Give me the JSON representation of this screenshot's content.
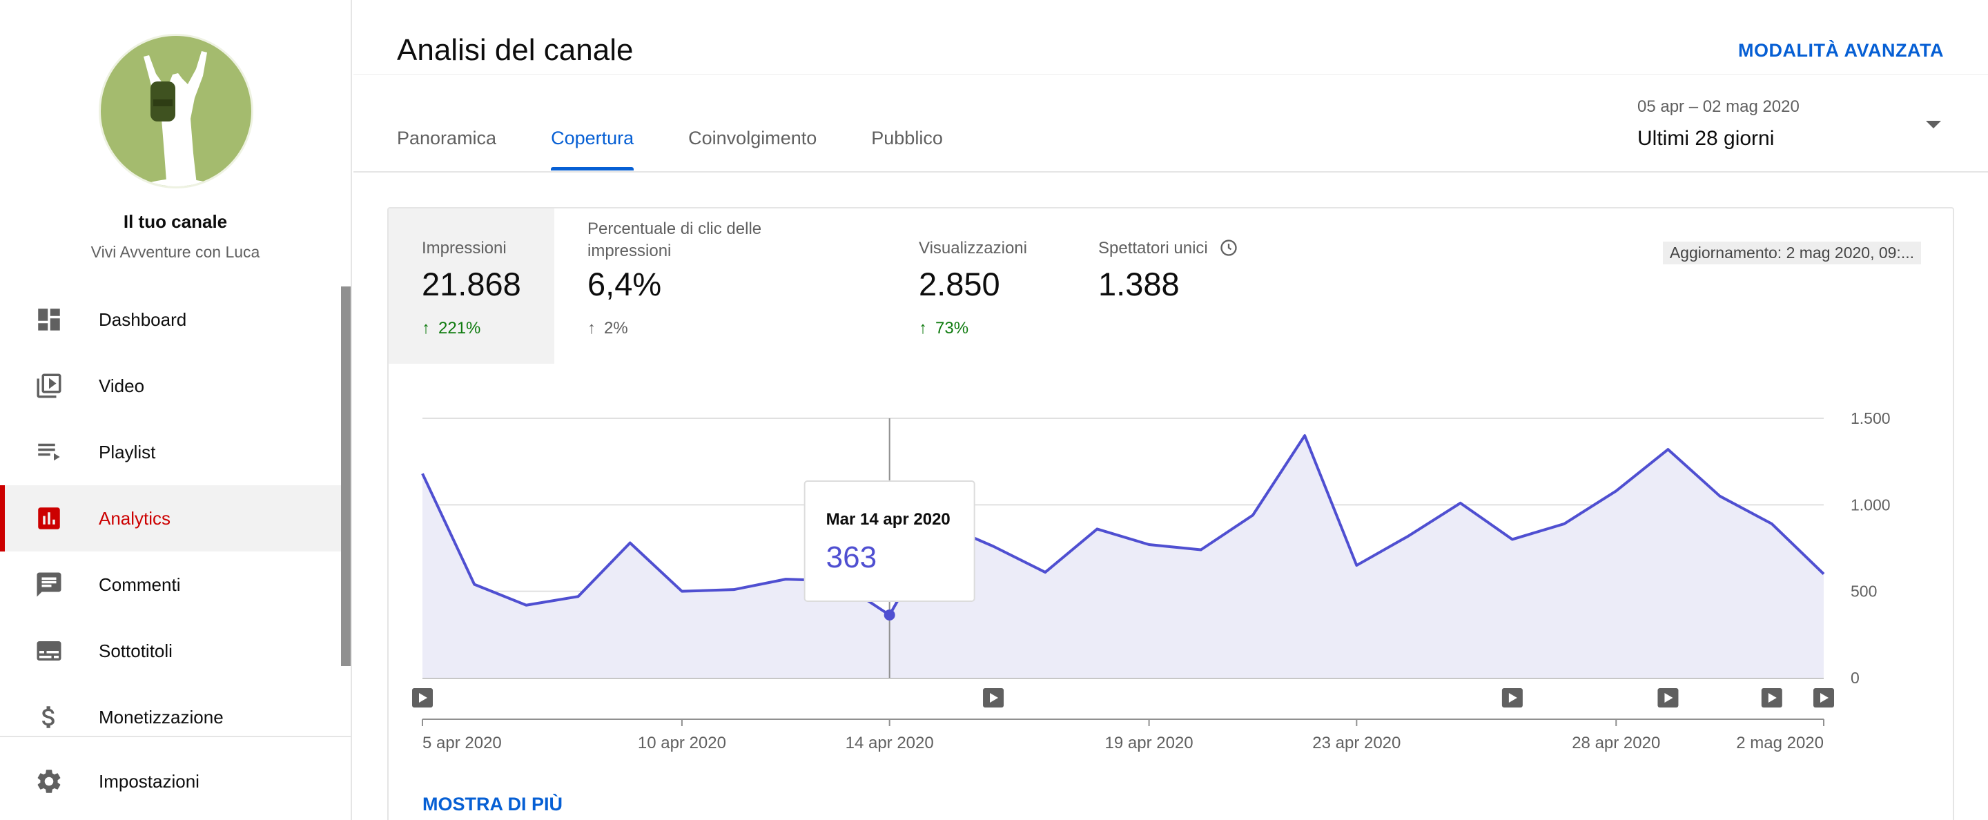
{
  "sidebar": {
    "channel_title": "Il tuo canale",
    "channel_subtitle": "Vivi Avventure con Luca",
    "items": [
      {
        "label": "Dashboard",
        "icon": "dashboard-icon"
      },
      {
        "label": "Video",
        "icon": "video-library-icon"
      },
      {
        "label": "Playlist",
        "icon": "playlist-icon"
      },
      {
        "label": "Analytics",
        "icon": "analytics-icon",
        "active": true
      },
      {
        "label": "Commenti",
        "icon": "comments-icon"
      },
      {
        "label": "Sottotitoli",
        "icon": "subtitles-icon"
      },
      {
        "label": "Monetizzazione",
        "icon": "dollar-icon"
      }
    ],
    "settings_label": "Impostazioni",
    "accent_color": "#cc0000"
  },
  "header": {
    "title": "Analisi del canale",
    "advanced_mode": "MODALITÀ AVANZATA",
    "tabs": [
      {
        "label": "Panoramica"
      },
      {
        "label": "Copertura",
        "active": true
      },
      {
        "label": "Coinvolgimento"
      },
      {
        "label": "Pubblico"
      }
    ],
    "date_range": "05 apr – 02 mag 2020",
    "date_preset": "Ultimi 28 giorni"
  },
  "metrics": [
    {
      "label": "Impressioni",
      "value": "21.868",
      "delta": "221%",
      "trend": "up-positive",
      "selected": true
    },
    {
      "label": "Percentuale di clic delle impressioni",
      "value": "6,4%",
      "delta": "2%",
      "trend": "up-neutral"
    },
    {
      "label": "Visualizzazioni",
      "value": "2.850",
      "delta": "73%",
      "trend": "up-positive"
    },
    {
      "label": "Spettatori unici",
      "value": "1.388",
      "icon": "clock-icon"
    }
  ],
  "updated_label": "Aggiornamento: 2 mag 2020, 09:...",
  "show_more": "MOSTRA DI PIÙ",
  "tooltip": {
    "date": "Mar 14 apr 2020",
    "value": "363"
  },
  "chart_data": {
    "type": "area",
    "x": [
      "5 apr",
      "6 apr",
      "7 apr",
      "8 apr",
      "9 apr",
      "10 apr",
      "11 apr",
      "12 apr",
      "13 apr",
      "14 apr",
      "15 apr",
      "16 apr",
      "17 apr",
      "18 apr",
      "19 apr",
      "20 apr",
      "21 apr",
      "22 apr",
      "23 apr",
      "24 apr",
      "25 apr",
      "26 apr",
      "27 apr",
      "28 apr",
      "29 apr",
      "30 apr",
      "1 mag",
      "2 mag"
    ],
    "values": [
      1180,
      540,
      420,
      470,
      780,
      500,
      510,
      570,
      560,
      363,
      890,
      760,
      610,
      860,
      770,
      740,
      940,
      1400,
      650,
      820,
      1010,
      800,
      890,
      1080,
      1320,
      1050,
      890,
      600
    ],
    "ylim": [
      0,
      1500
    ],
    "yticks": [
      {
        "v": 0,
        "label": "0"
      },
      {
        "v": 500,
        "label": "500"
      },
      {
        "v": 1000,
        "label": "1.000"
      },
      {
        "v": 1500,
        "label": "1.500"
      }
    ],
    "xticks": [
      {
        "i": 0,
        "label": "5 apr 2020"
      },
      {
        "i": 5,
        "label": "10 apr 2020"
      },
      {
        "i": 9,
        "label": "14 apr 2020"
      },
      {
        "i": 14,
        "label": "19 apr 2020"
      },
      {
        "i": 18,
        "label": "23 apr 2020"
      },
      {
        "i": 23,
        "label": "28 apr 2020"
      },
      {
        "i": 27,
        "label": "2 mag 2020"
      }
    ],
    "video_markers": [
      0,
      11,
      21,
      24,
      26,
      27
    ],
    "highlight_index": 9,
    "line_color": "#4f4fd1",
    "fill_color": "#ececf8",
    "grid": true
  }
}
